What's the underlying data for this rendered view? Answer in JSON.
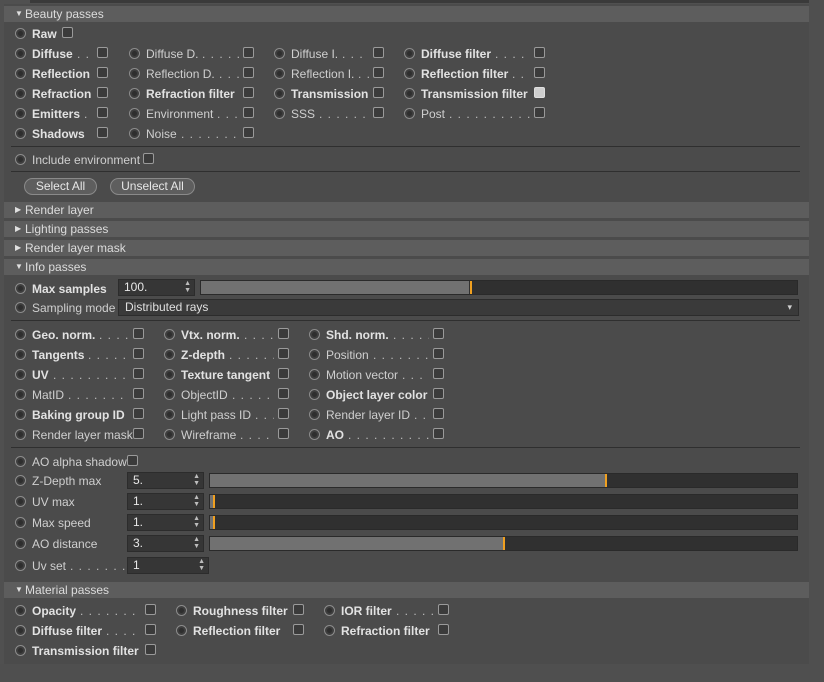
{
  "sections": {
    "beauty": "Beauty passes",
    "render_layer": "Render layer",
    "lighting": "Lighting passes",
    "render_layer_mask": "Render layer mask",
    "info": "Info passes",
    "material": "Material passes"
  },
  "beauty": {
    "raw": "Raw",
    "items": [
      {
        "label": "Diffuse",
        "bold": true,
        "dots": ". . ."
      },
      {
        "label": "Diffuse D.",
        "bold": false,
        "dots": ". . . . . . . ."
      },
      {
        "label": "Diffuse I.",
        "bold": false,
        "dots": ". . . . . . ."
      },
      {
        "label": "Diffuse filter",
        "bold": true,
        "dots": ". . . . . ."
      },
      {
        "label": "Reflection",
        "bold": true,
        "dots": ""
      },
      {
        "label": "Reflection D.",
        "bold": false,
        "dots": ". . . . ."
      },
      {
        "label": "Reflection I.",
        "bold": false,
        "dots": ". . ."
      },
      {
        "label": "Reflection filter",
        "bold": true,
        "dots": ". . ."
      },
      {
        "label": "Refraction",
        "bold": true,
        "dots": ""
      },
      {
        "label": "Refraction filter",
        "bold": true,
        "dots": ""
      },
      {
        "label": "Transmission",
        "bold": true,
        "dots": ""
      },
      {
        "label": "Transmission filter",
        "bold": true,
        "dots": ""
      },
      {
        "label": "Emitters",
        "bold": true,
        "dots": ". ."
      },
      {
        "label": "Environment",
        "bold": false,
        "dots": ". . . ."
      },
      {
        "label": "SSS",
        "bold": false,
        "dots": ". . . . . . . . ."
      },
      {
        "label": "Post",
        "bold": false,
        "dots": ". . . . . . . . . . . ."
      },
      {
        "label": "Shadows",
        "bold": true,
        "dots": ""
      },
      {
        "label": "Noise",
        "bold": false,
        "dots": ". . . . . . . . . . . ."
      }
    ],
    "include_env": "Include environment",
    "select_all": "Select All",
    "unselect_all": "Unselect All"
  },
  "info": {
    "max_samples_label": "Max samples",
    "max_samples_value": "100.",
    "max_samples_level": 0.45,
    "sampling_mode_label": "Sampling mode",
    "sampling_mode_value": "Distributed rays",
    "items": [
      {
        "label": "Geo. norm.",
        "bold": true,
        "dots": ". . . . ."
      },
      {
        "label": "Vtx. norm.",
        "bold": true,
        "dots": ". . . . ."
      },
      {
        "label": "Shd. norm.",
        "bold": true,
        "dots": ". . . . . ."
      },
      {
        "label": "Tangents",
        "bold": true,
        "dots": ". . . . . . ."
      },
      {
        "label": "Z-depth",
        "bold": true,
        "dots": ". . . . . . ."
      },
      {
        "label": "Position",
        "bold": false,
        "dots": ". . . . . . . . . . ."
      },
      {
        "label": "UV",
        "bold": true,
        "dots": ". . . . . . . . . . . . ."
      },
      {
        "label": "Texture tangent",
        "bold": true,
        "dots": ""
      },
      {
        "label": "Motion vector",
        "bold": false,
        "dots": ". . . . ."
      },
      {
        "label": "MatID",
        "bold": false,
        "dots": ". . . . . . . . . ."
      },
      {
        "label": "ObjectID",
        "bold": false,
        "dots": ". . . . . . ."
      },
      {
        "label": "Object layer color",
        "bold": true,
        "dots": ""
      },
      {
        "label": "Baking group ID",
        "bold": true,
        "dots": ""
      },
      {
        "label": "Light pass ID",
        "bold": false,
        "dots": ". . . ."
      },
      {
        "label": "Render layer ID",
        "bold": false,
        "dots": ". . . ."
      },
      {
        "label": "Render layer mask",
        "bold": false,
        "dots": ""
      },
      {
        "label": "Wireframe",
        "bold": false,
        "dots": ". . . . . ."
      },
      {
        "label": "AO",
        "bold": true,
        "dots": ". . . . . . . . . . . . . ."
      }
    ],
    "ao_alpha_shadow": "AO alpha shadow",
    "params": [
      {
        "label": "Z-Depth max",
        "dots": ". . . .",
        "value": "5.",
        "level": 0.675
      },
      {
        "label": "UV max",
        "dots": ". . . . . . . .",
        "value": "1.",
        "level": 0.006
      },
      {
        "label": "Max speed",
        "dots": ". . . . . .",
        "value": "1.",
        "level": 0.006
      },
      {
        "label": "AO distance",
        "dots": ". . . . .",
        "value": "3.",
        "level": 0.5
      }
    ],
    "uv_set_label": "Uv set",
    "uv_set_dots": ". . . . . . . . .",
    "uv_set_value": "1"
  },
  "material": {
    "items": [
      {
        "label": "Opacity",
        "bold": true,
        "dots": ". . . . . . . . . . ."
      },
      {
        "label": "Roughness filter",
        "bold": true,
        "dots": ""
      },
      {
        "label": "IOR filter",
        "bold": true,
        "dots": ". . . . . ."
      },
      {
        "label": "Diffuse filter",
        "bold": true,
        "dots": ". . . . . . ."
      },
      {
        "label": "Reflection filter",
        "bold": true,
        "dots": ""
      },
      {
        "label": "Refraction filter",
        "bold": true,
        "dots": ""
      },
      {
        "label": "Transmission filter",
        "bold": true,
        "dots": ""
      }
    ]
  },
  "colors": {
    "accent": "#f0a020",
    "panel": "#4b4b4b",
    "header": "#5d5d5d"
  }
}
